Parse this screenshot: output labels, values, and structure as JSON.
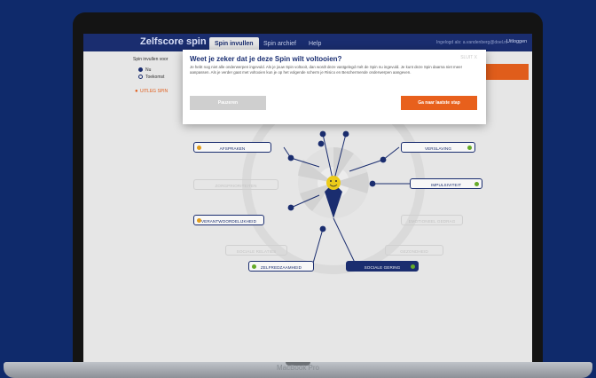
{
  "device_label": "MacBook Pro",
  "app": {
    "brand": "Zelfscore spin",
    "tabs": [
      "Spin invullen",
      "Spin archief",
      "Help"
    ],
    "nav_right": "Ingelogd als: a.vandenberg@doel.nl",
    "logout": "Uitloggen"
  },
  "left_panel": {
    "heading": "Spin invullen voor",
    "options": [
      "Nu",
      "Toekomst"
    ],
    "uitleg": "UITLEG SPIN"
  },
  "dialog": {
    "title": "Weet je zeker dat je deze Spin wilt voltooien?",
    "close": "SLUIT X",
    "body": "Je hebt nog niet alle onderwerpen ingevuld. Als je jouw Spin voltooit, dan wordt deze vastgelegd mét de Spin nu ingevuld. Je kunt deze Spin daarna niet meer aanpassen. Als je verder gaat met voltooien kun je op het volgende scherm je Risico en Beschermende onderwerpen aangeven.",
    "pause_button": "Pauzeren",
    "next_button": "Ga naar laatste stap"
  },
  "spin": {
    "labels": [
      {
        "text": "AFSPRAKEN",
        "state": "active",
        "indicator": "orange",
        "indicator_side": "left"
      },
      {
        "text": "VERSLAVING",
        "state": "active",
        "indicator": "green",
        "indicator_side": "right"
      },
      {
        "text": "ZORGPRIORITEITEN",
        "state": "faded"
      },
      {
        "text": "IMPULSIVITEIT",
        "state": "active",
        "indicator": "green",
        "indicator_side": "right"
      },
      {
        "text": "VERANTWOORDELIJKHEID",
        "state": "active",
        "indicator": "orange",
        "indicator_side": "left"
      },
      {
        "text": "EMOTIONEEL GEDRAG",
        "state": "faded"
      },
      {
        "text": "SOCIALE RELATIES",
        "state": "faded"
      },
      {
        "text": "GEZONDHEID",
        "state": "faded"
      },
      {
        "text": "ZELFREDZAAMHEID",
        "state": "active",
        "indicator": "green",
        "indicator_side": "left"
      },
      {
        "text": "SOCIALE GERING",
        "state": "dark",
        "indicator": "green",
        "indicator_side": "right"
      }
    ],
    "center_icon": "smiley-face-icon"
  },
  "colors": {
    "navy": "#1b2f73",
    "orange": "#e8601c",
    "green": "#69b02a",
    "background": "#0f2a6b"
  }
}
